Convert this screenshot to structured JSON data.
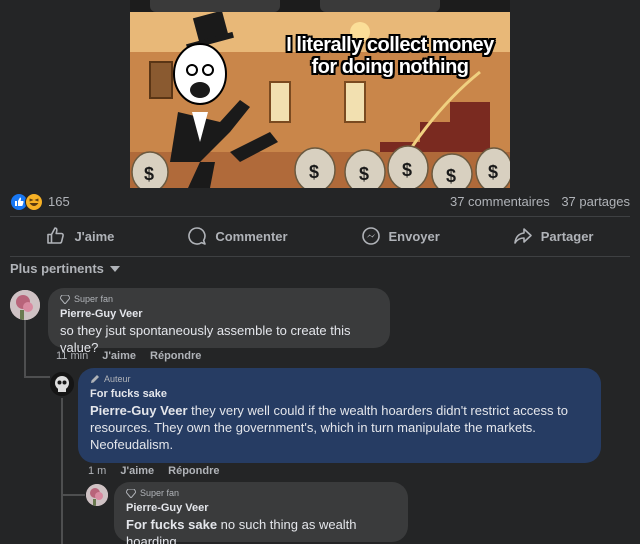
{
  "post": {
    "meme_caption_line1": "I literally collect money",
    "meme_caption_line2": "for doing nothing"
  },
  "reactions": {
    "icons": [
      "like-icon",
      "haha-icon"
    ],
    "count": "165",
    "comments": "37 commentaires",
    "shares": "37 partages"
  },
  "actions": {
    "like": "J'aime",
    "comment": "Commenter",
    "send": "Envoyer",
    "share": "Partager"
  },
  "sort": {
    "label": "Plus pertinents"
  },
  "comments": [
    {
      "badge": "Super fan",
      "author": "Pierre-Guy Veer",
      "text": "so they jsut spontaneously assemble to create this value?",
      "time": "11 min",
      "like": "J'aime",
      "reply": "Répondre"
    },
    {
      "badge": "Auteur",
      "author": "For fucks sake",
      "mention": "Pierre-Guy Veer",
      "text": " they very well could if the wealth hoarders didn't restrict access to resources. They own the government's, which in turn manipulate the markets. Neofeudalism.",
      "time": "1 m",
      "like": "J'aime",
      "reply": "Répondre"
    },
    {
      "badge": "Super fan",
      "author": "Pierre-Guy Veer",
      "mention": "For fucks sake",
      "text": " no such thing as wealth hoarding"
    }
  ],
  "colors": {
    "background": "#242526",
    "bubble": "#3a3b3c",
    "author_bubble": "#263c63",
    "secondary_text": "#b0b3b8",
    "like_blue": "#1877f2"
  }
}
